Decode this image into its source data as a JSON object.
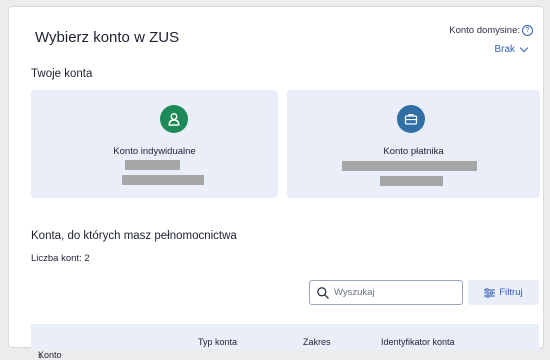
{
  "header": {
    "title": "Wybierz konto w ZUS",
    "default_account_label": "Konto domysine:",
    "default_account_value": "Brak"
  },
  "own_accounts": {
    "section_title": "Twoje konta",
    "cards": [
      {
        "label": "Konto indywidualne",
        "icon": "person-icon",
        "color": "#1e8a5a"
      },
      {
        "label": "Konto płatnika",
        "icon": "briefcase-icon",
        "color": "#2f6fa6"
      }
    ]
  },
  "proxy_accounts": {
    "section_title": "Konta, do których masz pełnomocnictwa",
    "count_label": "Liczba kont: 2",
    "search_placeholder": "Wyszukaj",
    "filter_label": "Filtruj",
    "columns": [
      "Konto",
      "Typ konta",
      "Zakres",
      "Identyfikator konta"
    ],
    "sort_indicator": "↓"
  },
  "colors": {
    "accent": "#2f5fb6",
    "card_bg": "#e9eef8"
  }
}
